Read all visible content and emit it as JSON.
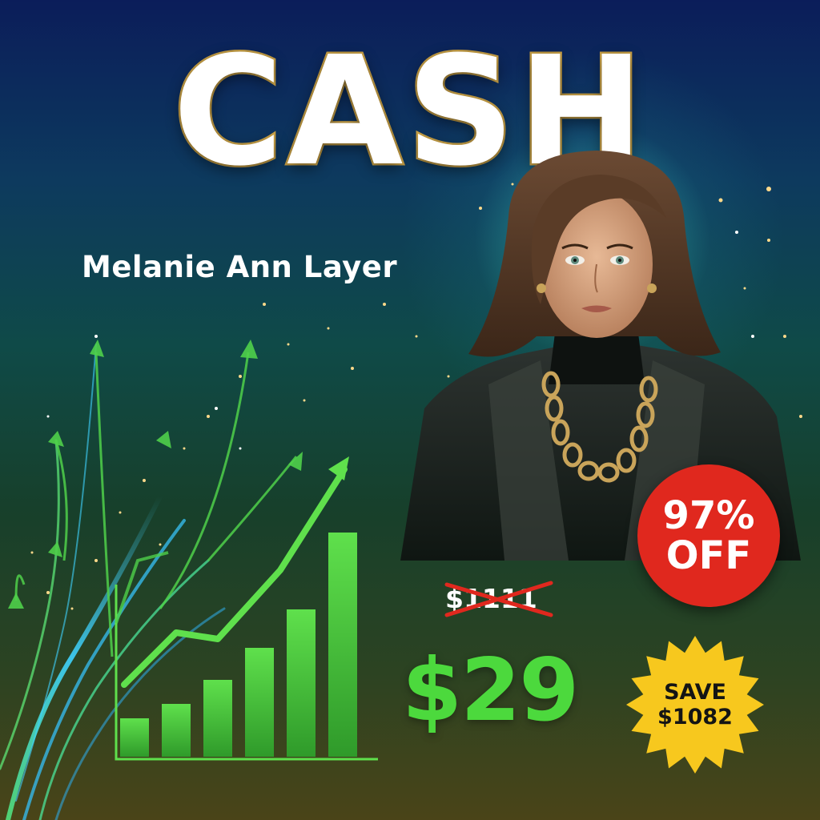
{
  "title": "CASH",
  "author": "Melanie Ann Layer",
  "pricing": {
    "original_price": "$1111",
    "price": "$29",
    "discount_line1": "97%",
    "discount_line2": "OFF",
    "save_line1": "SAVE",
    "save_line2": "$1082"
  },
  "icons": {
    "chart": "growth-bar-chart-icon",
    "arrows": "upward-arrow-icon"
  },
  "colors": {
    "price_green": "#4cd93d",
    "badge_red": "#e0281e",
    "burst_yellow": "#f7c81e",
    "title_outline": "#c8a046"
  }
}
